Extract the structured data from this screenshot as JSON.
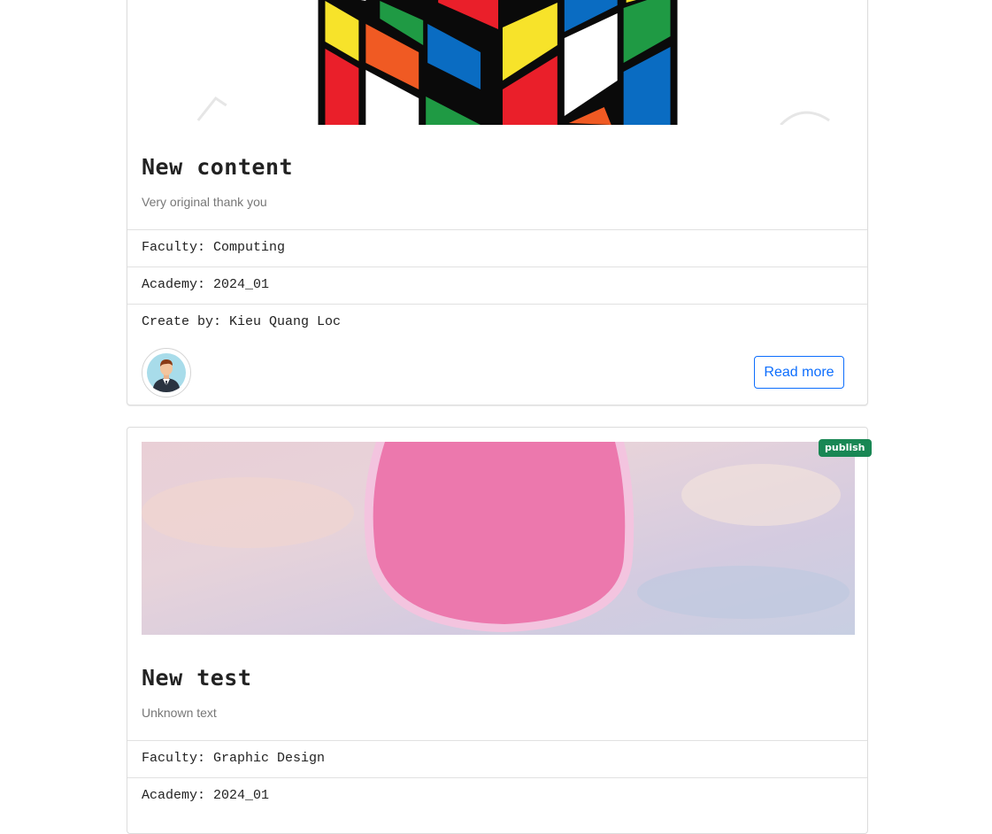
{
  "posts": [
    {
      "title": "New content",
      "description": "Very original thank you",
      "faculty_label": "Faculty:",
      "faculty": "Computing",
      "academy_label": "Academy:",
      "academy": "2024_01",
      "creator_label": "Create by:",
      "creator": "Kieu Quang Loc",
      "read_more": "Read more"
    },
    {
      "title": "New test",
      "description": "Unknown text",
      "status": "publish",
      "faculty_label": "Faculty:",
      "faculty": "Graphic Design",
      "academy_label": "Academy:",
      "academy": "2024_01"
    }
  ],
  "colors": {
    "primary": "#0d6efd",
    "publish_badge": "#198754"
  }
}
